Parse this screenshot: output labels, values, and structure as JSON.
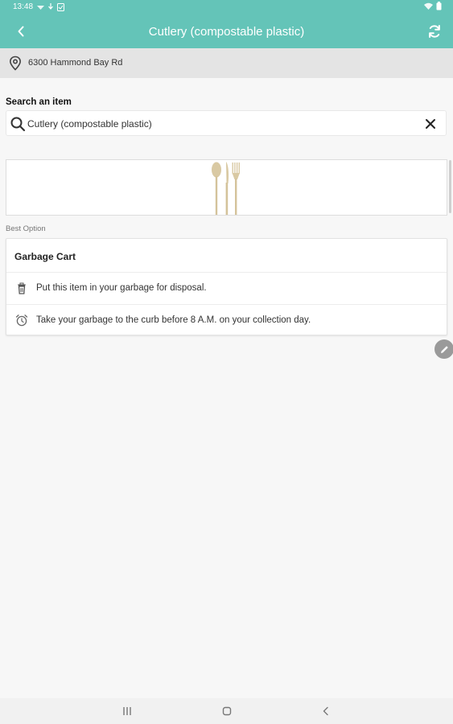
{
  "status_bar": {
    "time": "13:48"
  },
  "app_bar": {
    "title": "Cutlery (compostable plastic)"
  },
  "address": {
    "text": "6300 Hammond Bay Rd"
  },
  "search": {
    "label": "Search an item",
    "value": "Cutlery (compostable plastic)"
  },
  "best_option": {
    "label": "Best Option",
    "title": "Garbage Cart",
    "rows": [
      {
        "icon": "garbage-bin-icon",
        "text": "Put this item in your garbage for disposal."
      },
      {
        "icon": "alarm-clock-icon",
        "text": "Take your garbage to the curb before 8 A.M. on your collection day."
      }
    ]
  },
  "icons": {
    "back": "back-arrow-icon",
    "refresh": "refresh-icon",
    "location": "location-pin-icon",
    "search": "search-icon",
    "clear": "close-icon",
    "edit": "pencil-icon"
  },
  "colors": {
    "primary": "#64c4b8",
    "address_bg": "#e4e4e4",
    "background": "#f7f7f7",
    "cutlery": "#d9c9a3"
  }
}
